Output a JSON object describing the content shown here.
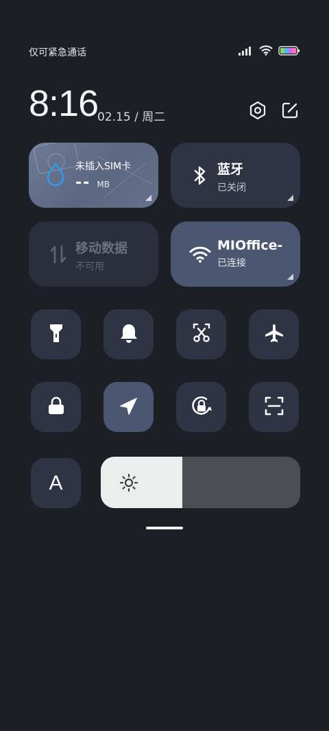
{
  "status_bar": {
    "carrier_text": "仅可紧急通话",
    "icons": [
      "signal-icon",
      "wifi-icon",
      "battery-icon"
    ]
  },
  "header": {
    "time": "8:16",
    "date": "02.15 / 周二",
    "settings_icon": "gear-icon",
    "edit_icon": "edit-icon"
  },
  "tiles": {
    "data_usage": {
      "title": "未插入SIM卡",
      "value": "--",
      "unit": "MB",
      "icon": "water-drop-icon"
    },
    "bluetooth": {
      "title": "蓝牙",
      "status": "已关闭",
      "icon": "bluetooth-icon"
    },
    "mobile_data": {
      "title": "移动数据",
      "status": "不可用",
      "icon": "data-arrows-icon"
    },
    "wifi": {
      "title": "MIOffice-",
      "status": "已连接",
      "icon": "wifi-icon"
    }
  },
  "toggles": [
    {
      "name": "flashlight",
      "icon": "flashlight-icon",
      "active": false
    },
    {
      "name": "ringtone",
      "icon": "bell-icon",
      "active": false
    },
    {
      "name": "screenshot",
      "icon": "scissors-icon",
      "active": false
    },
    {
      "name": "airplane",
      "icon": "airplane-icon",
      "active": false
    },
    {
      "name": "lock-screen",
      "icon": "lock-icon",
      "active": false
    },
    {
      "name": "location",
      "icon": "location-arrow-icon",
      "active": true
    },
    {
      "name": "rotation-lock",
      "icon": "rotation-lock-icon",
      "active": false
    },
    {
      "name": "scan",
      "icon": "scan-icon",
      "active": false
    }
  ],
  "bottom": {
    "auto_brightness_label": "A",
    "brightness_level": 0.41,
    "brightness_icon": "sun-icon"
  },
  "colors": {
    "background": "#1c1f26",
    "tile": "#2e3443",
    "tile_active": "#4b5670",
    "tile_disabled": "#2a2f3b",
    "accent_blue": "#2e9bf0"
  }
}
